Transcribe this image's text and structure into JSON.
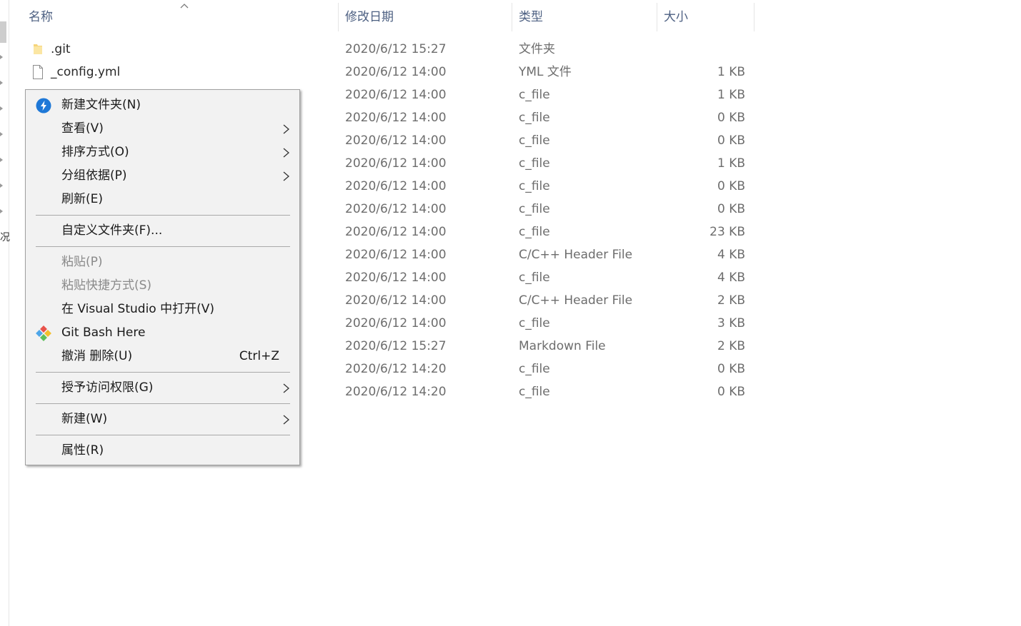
{
  "columns": {
    "name": "名称",
    "date": "修改日期",
    "type": "类型",
    "size": "大小"
  },
  "files": [
    {
      "name": ".git",
      "date": "2020/6/12 15:27",
      "type": "文件夹",
      "size": "",
      "icon": "folder-icon"
    },
    {
      "name": "_config.yml",
      "date": "2020/6/12 14:00",
      "type": "YML 文件",
      "size": "1 KB",
      "icon": "file-icon"
    },
    {
      "name": "",
      "date": "2020/6/12 14:00",
      "type": "c_file",
      "size": "1 KB"
    },
    {
      "name": "",
      "date": "2020/6/12 14:00",
      "type": "c_file",
      "size": "0 KB"
    },
    {
      "name": "",
      "date": "2020/6/12 14:00",
      "type": "c_file",
      "size": "0 KB"
    },
    {
      "name": "",
      "date": "2020/6/12 14:00",
      "type": "c_file",
      "size": "1 KB"
    },
    {
      "name": "",
      "date": "2020/6/12 14:00",
      "type": "c_file",
      "size": "0 KB"
    },
    {
      "name": "",
      "date": "2020/6/12 14:00",
      "type": "c_file",
      "size": "0 KB"
    },
    {
      "name": "",
      "date": "2020/6/12 14:00",
      "type": "c_file",
      "size": "23 KB"
    },
    {
      "name": "",
      "date": "2020/6/12 14:00",
      "type": "C/C++ Header File",
      "size": "4 KB"
    },
    {
      "name": "",
      "date": "2020/6/12 14:00",
      "type": "c_file",
      "size": "4 KB"
    },
    {
      "name": "",
      "date": "2020/6/12 14:00",
      "type": "C/C++ Header File",
      "size": "2 KB"
    },
    {
      "name": "",
      "date": "2020/6/12 14:00",
      "type": "c_file",
      "size": "3 KB"
    },
    {
      "name": "",
      "date": "2020/6/12 15:27",
      "type": "Markdown File",
      "size": "2 KB"
    },
    {
      "name": "",
      "date": "2020/6/12 14:20",
      "type": "c_file",
      "size": "0 KB"
    },
    {
      "name": "",
      "date": "2020/6/12 14:20",
      "type": "c_file",
      "size": "0 KB"
    }
  ],
  "context_menu": {
    "items": [
      {
        "label": "新建文件夹(N)"
      },
      {
        "label": "查看(V)"
      },
      {
        "label": "排序方式(O)"
      },
      {
        "label": "分组依据(P)"
      },
      {
        "label": "刷新(E)"
      },
      {
        "label": "自定义文件夹(F)..."
      },
      {
        "label": "粘贴(P)"
      },
      {
        "label": "粘贴快捷方式(S)"
      },
      {
        "label": "在 Visual Studio 中打开(V)"
      },
      {
        "label": "Git Bash Here"
      },
      {
        "label": "撤消 删除(U)",
        "shortcut": "Ctrl+Z"
      },
      {
        "label": "授予访问权限(G)"
      },
      {
        "label": "新建(W)"
      },
      {
        "label": "属性(R)"
      }
    ]
  },
  "nav": {
    "partial_glyph": "况"
  },
  "colors": {
    "header_text": "#4d6082",
    "menu_bg": "#f2f2f2",
    "disabled_text": "#8a8a8a",
    "accent": "#1e78d7"
  }
}
